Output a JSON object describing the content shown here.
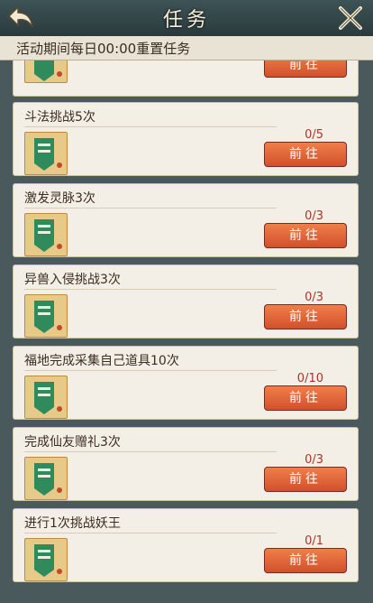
{
  "header": {
    "title": "任务"
  },
  "notice": "活动期间每日00:00重置任务",
  "top_button": "前往",
  "tasks": [
    {
      "name": "斗法挑战5次",
      "progress": "0/5",
      "button": "前往"
    },
    {
      "name": "激发灵脉3次",
      "progress": "0/3",
      "button": "前往"
    },
    {
      "name": "异兽入侵挑战3次",
      "progress": "0/3",
      "button": "前往"
    },
    {
      "name": "福地完成采集自己道具10次",
      "progress": "0/10",
      "button": "前往"
    },
    {
      "name": "完成仙友赠礼3次",
      "progress": "0/3",
      "button": "前往"
    },
    {
      "name": "进行1次挑战妖王",
      "progress": "0/1",
      "button": "前往"
    }
  ],
  "icons": {
    "back": "back-arrow-icon",
    "close": "close-swords-icon",
    "item": "scroll-banner-icon"
  },
  "colors": {
    "button": "#e36a3d",
    "progress": "#a8352a",
    "card": "#f3efe6"
  }
}
